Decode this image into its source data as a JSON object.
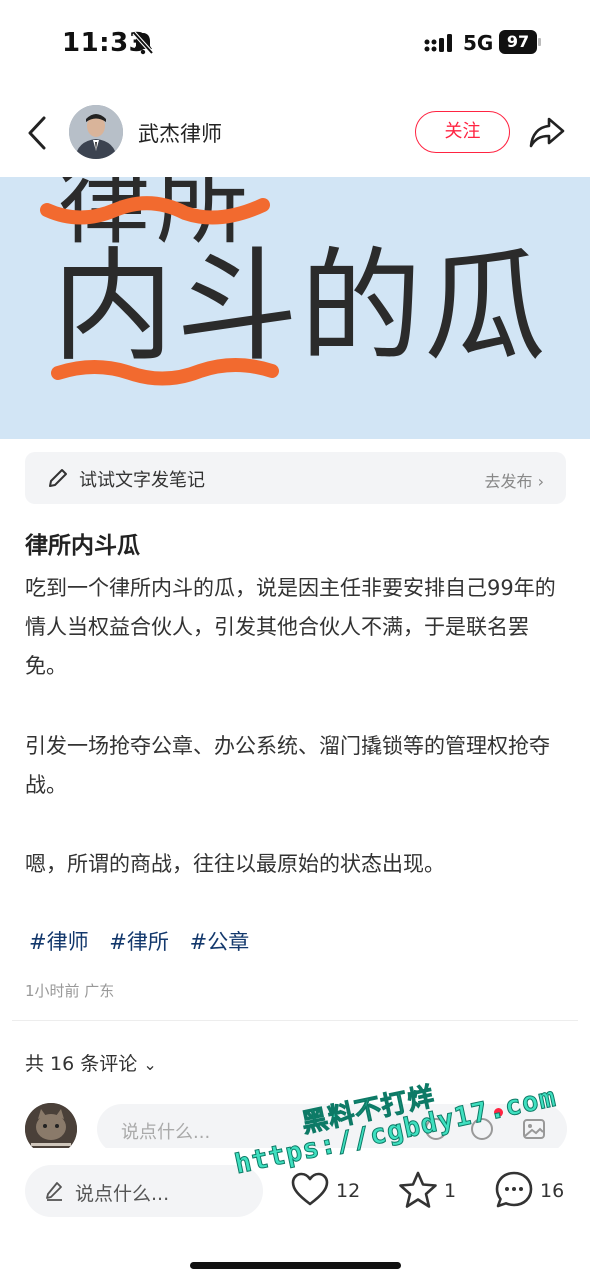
{
  "status_bar": {
    "time": "11:33",
    "network": "5G",
    "battery": "97"
  },
  "header": {
    "author_name": "武杰律师",
    "follow_label": "关注"
  },
  "banner": {
    "top_partial_text": "律所",
    "main_text": "内斗的瓜",
    "underline_color": "#f26a2f",
    "background_color": "#d2e5f5"
  },
  "note_prompt": {
    "text": "试试文字发笔记",
    "action": "去发布"
  },
  "post": {
    "title": "律所内斗瓜",
    "paragraphs": [
      "吃到一个律所内斗的瓜，说是因主任非要安排自己99年的情人当权益合伙人，引发其他合伙人不满，于是联名罢免。",
      "引发一场抢夺公章、办公系统、溜门撬锁等的管理权抢夺战。",
      "嗯，所谓的商战，往往以最原始的状态出现。"
    ],
    "tags": [
      "#律师",
      "#律所",
      "#公章"
    ],
    "meta": "1小时前 广东"
  },
  "comments": {
    "count_label": "共 16 条评论",
    "input_placeholder": "说点什么..."
  },
  "bottom_bar": {
    "input_placeholder": "说点什么...",
    "likes": "12",
    "collects": "1",
    "comments": "16"
  },
  "watermark": {
    "line1": "黑料不打烊",
    "line2": "https://cgbdy17.com"
  },
  "colors": {
    "accent": "#ff2442",
    "tag": "#13386c",
    "watermark": "#3fe0c0"
  }
}
